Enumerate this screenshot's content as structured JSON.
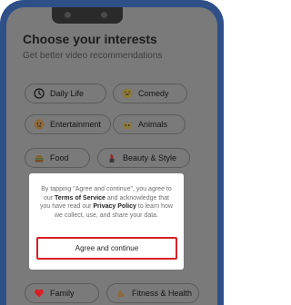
{
  "header": {
    "title": "Choose your interests",
    "subtitle": "Get better video recommendations"
  },
  "interests": [
    {
      "label": "Daily Life",
      "icon": "clock-icon"
    },
    {
      "label": "Comedy",
      "icon": "laughing-emoji-icon"
    },
    {
      "label": "Entertainment",
      "icon": "dancer-icon"
    },
    {
      "label": "Animals",
      "icon": "cat-icon"
    },
    {
      "label": "Food",
      "icon": "burger-icon"
    },
    {
      "label": "Beauty & Style",
      "icon": "lipstick-icon"
    },
    {
      "label": "Family",
      "icon": "heart-icon"
    },
    {
      "label": "Fitness & Health",
      "icon": "flexed-arm-icon"
    }
  ],
  "dialog": {
    "text_1": "By tapping \"Agree and continue\", you agree to our ",
    "terms_link": "Terms of Service",
    "text_2": " and acknowledge that you have read our ",
    "privacy_link": "Privacy Policy",
    "text_3": " to learn how we collect, use, and share your data.",
    "button_label": "Agree and continue"
  },
  "colors": {
    "frame": "#2f4f88",
    "overlay": "#7a7a7a",
    "button_border": "#d81f26",
    "heart": "#d81f26"
  }
}
